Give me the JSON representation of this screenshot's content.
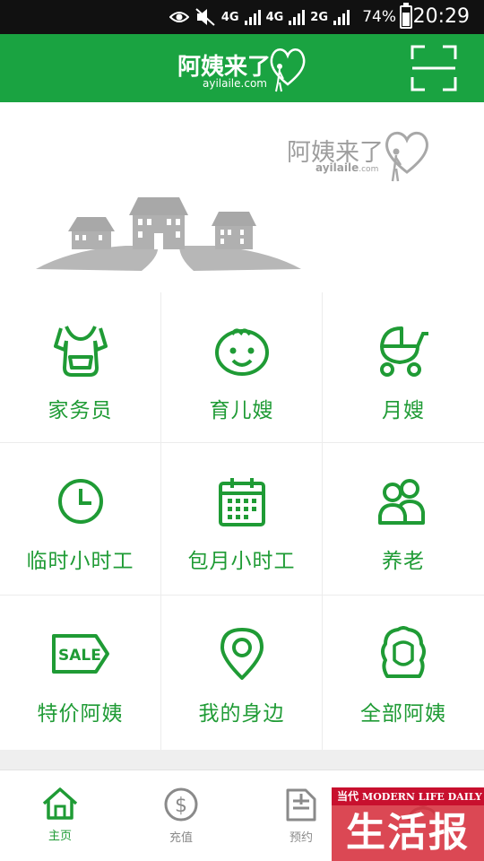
{
  "status_bar": {
    "network_1": "4G",
    "network_2": "4G",
    "network_3": "2G",
    "battery_percent": "74%",
    "time": "20:29"
  },
  "header": {
    "logo_cn": "阿姨来了",
    "logo_en": "ayilaile.com",
    "scan_icon": "scan-frame-icon",
    "color": "#1aa341"
  },
  "banner": {
    "brand_cn": "阿姨来了",
    "brand_en": "ayilaile",
    "brand_en_suffix": ".com"
  },
  "services": [
    {
      "label": "家务员",
      "icon": "apron-icon"
    },
    {
      "label": "育儿嫂",
      "icon": "baby-face-icon"
    },
    {
      "label": "月嫂",
      "icon": "stroller-icon"
    },
    {
      "label": "临时小时工",
      "icon": "clock-icon"
    },
    {
      "label": "包月小时工",
      "icon": "calendar-icon"
    },
    {
      "label": "养老",
      "icon": "elderly-people-icon"
    },
    {
      "label": "特价阿姨",
      "icon": "sale-tag-icon"
    },
    {
      "label": "我的身边",
      "icon": "location-pin-icon"
    },
    {
      "label": "全部阿姨",
      "icon": "woman-hair-icon"
    }
  ],
  "tabs": [
    {
      "label": "主页",
      "icon": "home-icon",
      "active": true
    },
    {
      "label": "充值",
      "icon": "dollar-coin-icon",
      "active": false
    },
    {
      "label": "预约",
      "icon": "clipboard-icon",
      "active": false
    },
    {
      "label": "",
      "icon": "user-icon",
      "active": false
    }
  ],
  "watermark": {
    "top_cn": "当代",
    "top_en": "MODERN LIFE DAILY",
    "main": "生活报"
  },
  "colors": {
    "accent": "#1f9b35",
    "header": "#1aa341",
    "inactive": "#8a8a8a",
    "watermark_red": "#c8102e"
  }
}
